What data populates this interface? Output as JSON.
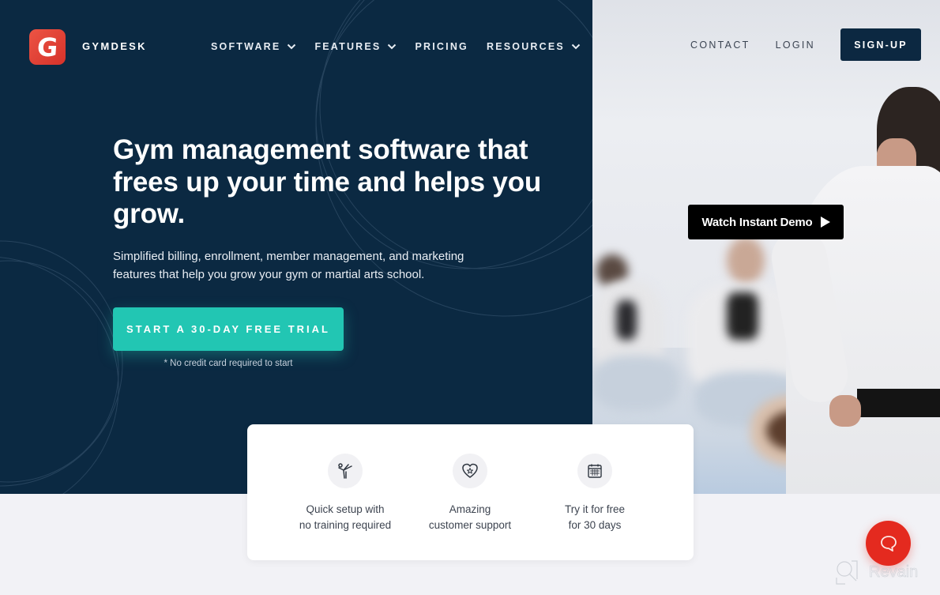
{
  "brand": {
    "logo_letter": "G",
    "name": "GYMDESK",
    "logo_color": "#e0392e"
  },
  "nav": {
    "items": [
      {
        "label": "SOFTWARE",
        "has_dropdown": true
      },
      {
        "label": "FEATURES",
        "has_dropdown": true
      },
      {
        "label": "PRICING",
        "has_dropdown": false
      },
      {
        "label": "RESOURCES",
        "has_dropdown": true
      }
    ]
  },
  "top_right": {
    "contact": "CONTACT",
    "login": "LOGIN",
    "signup": "SIGN-UP"
  },
  "hero": {
    "headline": "Gym management software that frees up your time and helps you grow.",
    "subtext": "Simplified billing, enrollment, member management, and marketing features that help you grow your gym or martial arts school.",
    "cta_label": "START A 30-DAY FREE TRIAL",
    "cta_note": "* No credit card required to start",
    "demo_label": "Watch Instant Demo",
    "background_color": "#0b2942",
    "accent_color": "#22c6b3"
  },
  "features": [
    {
      "icon": "kick-icon",
      "line1": "Quick setup with",
      "line2": "no training required"
    },
    {
      "icon": "heart-star-icon",
      "line1": "Amazing",
      "line2": "customer support"
    },
    {
      "icon": "calendar-icon",
      "line1": "Try it for free",
      "line2": "for 30 days"
    }
  ],
  "chat_widget": {
    "icon": "chat-bubble-icon",
    "color": "#e42a1f"
  },
  "watermark": {
    "text": "Revain"
  }
}
